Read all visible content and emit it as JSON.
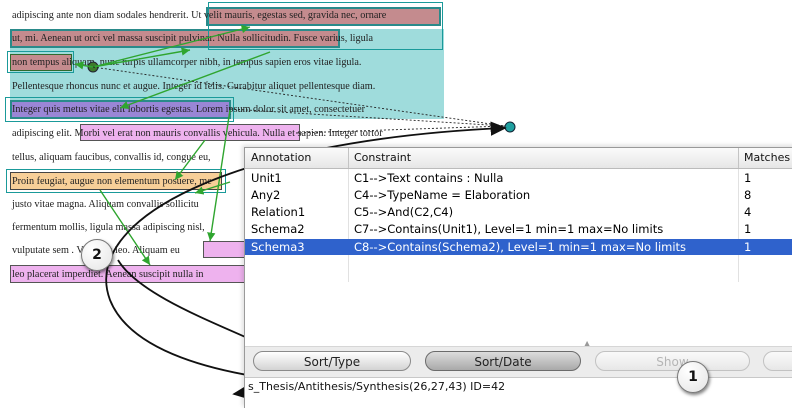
{
  "document": {
    "lines": [
      "adipiscing ante non diam sodales hendrerit. Ut velit mauris, egestas sed, gravida nec, ornare",
      "ut, mi. Aenean ut orci vel massa suscipit pulvinar. Nulla sollicitudin. Fusce varius, ligula",
      "non tempus aliquam, nunc turpis ullamcorper nibh, in tempus sapien eros vitae ligula.",
      "Pellentesque rhoncus nunc et augue. Integer id felis. Curabitur aliquet pellentesque diam.",
      "Integer quis metus vitae elit lobortis egestas. Lorem ipsum dolor sit amet, consectetuer",
      "adipiscing elit. Morbi vel erat non mauris convallis vehicula. Nulla et sapien. Integer tortor",
      "tellus, aliquam faucibus, convallis id, congue eu,",
      "Proin feugiat, augue non elementum posuere, me",
      "justo vitae magna. Aliquam convallis sollicitu",
      "fermentum mollis, ligula massa adipiscing nisl,",
      "vulputate sem        . Vivamus leo. Aliquam eu",
      "leo placerat imperdiet. Aenean suscipit nulla in"
    ]
  },
  "table": {
    "headers": [
      "Annotation",
      "Constraint",
      "Matches"
    ],
    "rows": [
      {
        "annotation": "Unit1",
        "constraint": "C1-->Text contains : Nulla",
        "matches": "1"
      },
      {
        "annotation": "Any2",
        "constraint": "C4-->TypeName = Elaboration",
        "matches": "8"
      },
      {
        "annotation": "Relation1",
        "constraint": "C5-->And(C2,C4)",
        "matches": "4"
      },
      {
        "annotation": "Schema2",
        "constraint": "C7-->Contains(Unit1), Level=1 min=1 max=No limits",
        "matches": "1"
      },
      {
        "annotation": "Schema3",
        "constraint": "C8-->Contains(Schema2), Level=1 min=1 max=No limits",
        "matches": "1"
      }
    ],
    "selected_row": 4
  },
  "buttons": {
    "sort_type": "Sort/Type",
    "sort_date": "Sort/Date",
    "show": "Show"
  },
  "status_bar": "s_Thesis/Antithesis/Synthesis(26,27,43) ID=42",
  "callouts": {
    "one": "1",
    "two": "2"
  },
  "colors": {
    "selection": "#2f62cc",
    "highlight_red": "#c48b8e",
    "highlight_cyan": "#9fdcdc",
    "highlight_purple": "#9a86d6",
    "highlight_pink": "#eeb2ee",
    "highlight_orange": "#f7cf98",
    "arrow_green": "#2fa52f"
  }
}
